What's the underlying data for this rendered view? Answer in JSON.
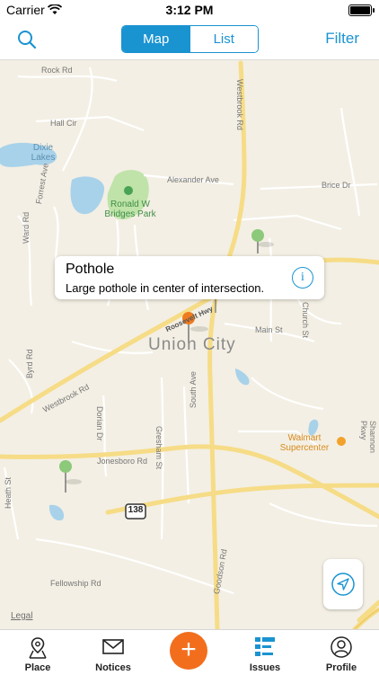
{
  "status_bar": {
    "carrier": "Carrier",
    "time": "3:12 PM"
  },
  "nav": {
    "segments": [
      "Map",
      "List"
    ],
    "selected_segment": "Map",
    "filter_label": "Filter"
  },
  "map": {
    "labels": {
      "rock_rd": "Rock Rd",
      "hall_cir": "Hall Cir",
      "dixie_lakes": "Dixie Lakes",
      "alexander_ave": "Alexander Ave",
      "brice_dr": "Brice Dr",
      "forrest_ave": "Forrest Ave",
      "ward_rd": "Ward Rd",
      "park_name": "Ronald W Bridges Park",
      "westbrook_rd_top": "Westbrook Rd",
      "roosevelt_hwy": "Roosevelt Hwy",
      "union_city": "Union City",
      "main_st": "Main St",
      "church_st": "Church St",
      "byrd_rd": "Byrd Rd",
      "westbrook_rd": "Westbrook Rd",
      "dorian_dr": "Dorian Dr",
      "gresham_st": "Gresham St",
      "south_ave": "South Ave",
      "walmart": "Walmart Supercenter",
      "shannon_pkwy": "Shannon Pkwy",
      "jonesboro_rd": "Jonesboro Rd",
      "heath_st": "Heath St",
      "route_138": "138",
      "goodson_rd": "Goodson Rd",
      "fellowship_rd": "Fellowship Rd",
      "legal": "Legal"
    },
    "callout": {
      "title": "Pothole",
      "description": "Large pothole in center of intersection."
    }
  },
  "tabs": [
    {
      "label": "Place",
      "icon": "place-icon"
    },
    {
      "label": "Notices",
      "icon": "envelope-icon"
    },
    {
      "label": "",
      "icon": "plus-icon"
    },
    {
      "label": "Issues",
      "icon": "list-icon"
    },
    {
      "label": "Profile",
      "icon": "person-icon"
    }
  ],
  "active_tab": "Issues",
  "colors": {
    "accent": "#1a93d1",
    "add_button": "#f26e1d",
    "map_bg": "#f3efe4",
    "road_major": "#f6dc86",
    "water": "#a8d2ea",
    "park": "#bfe3a9",
    "pin_green": "#8cc97a",
    "pin_orange": "#ef7b1f"
  }
}
